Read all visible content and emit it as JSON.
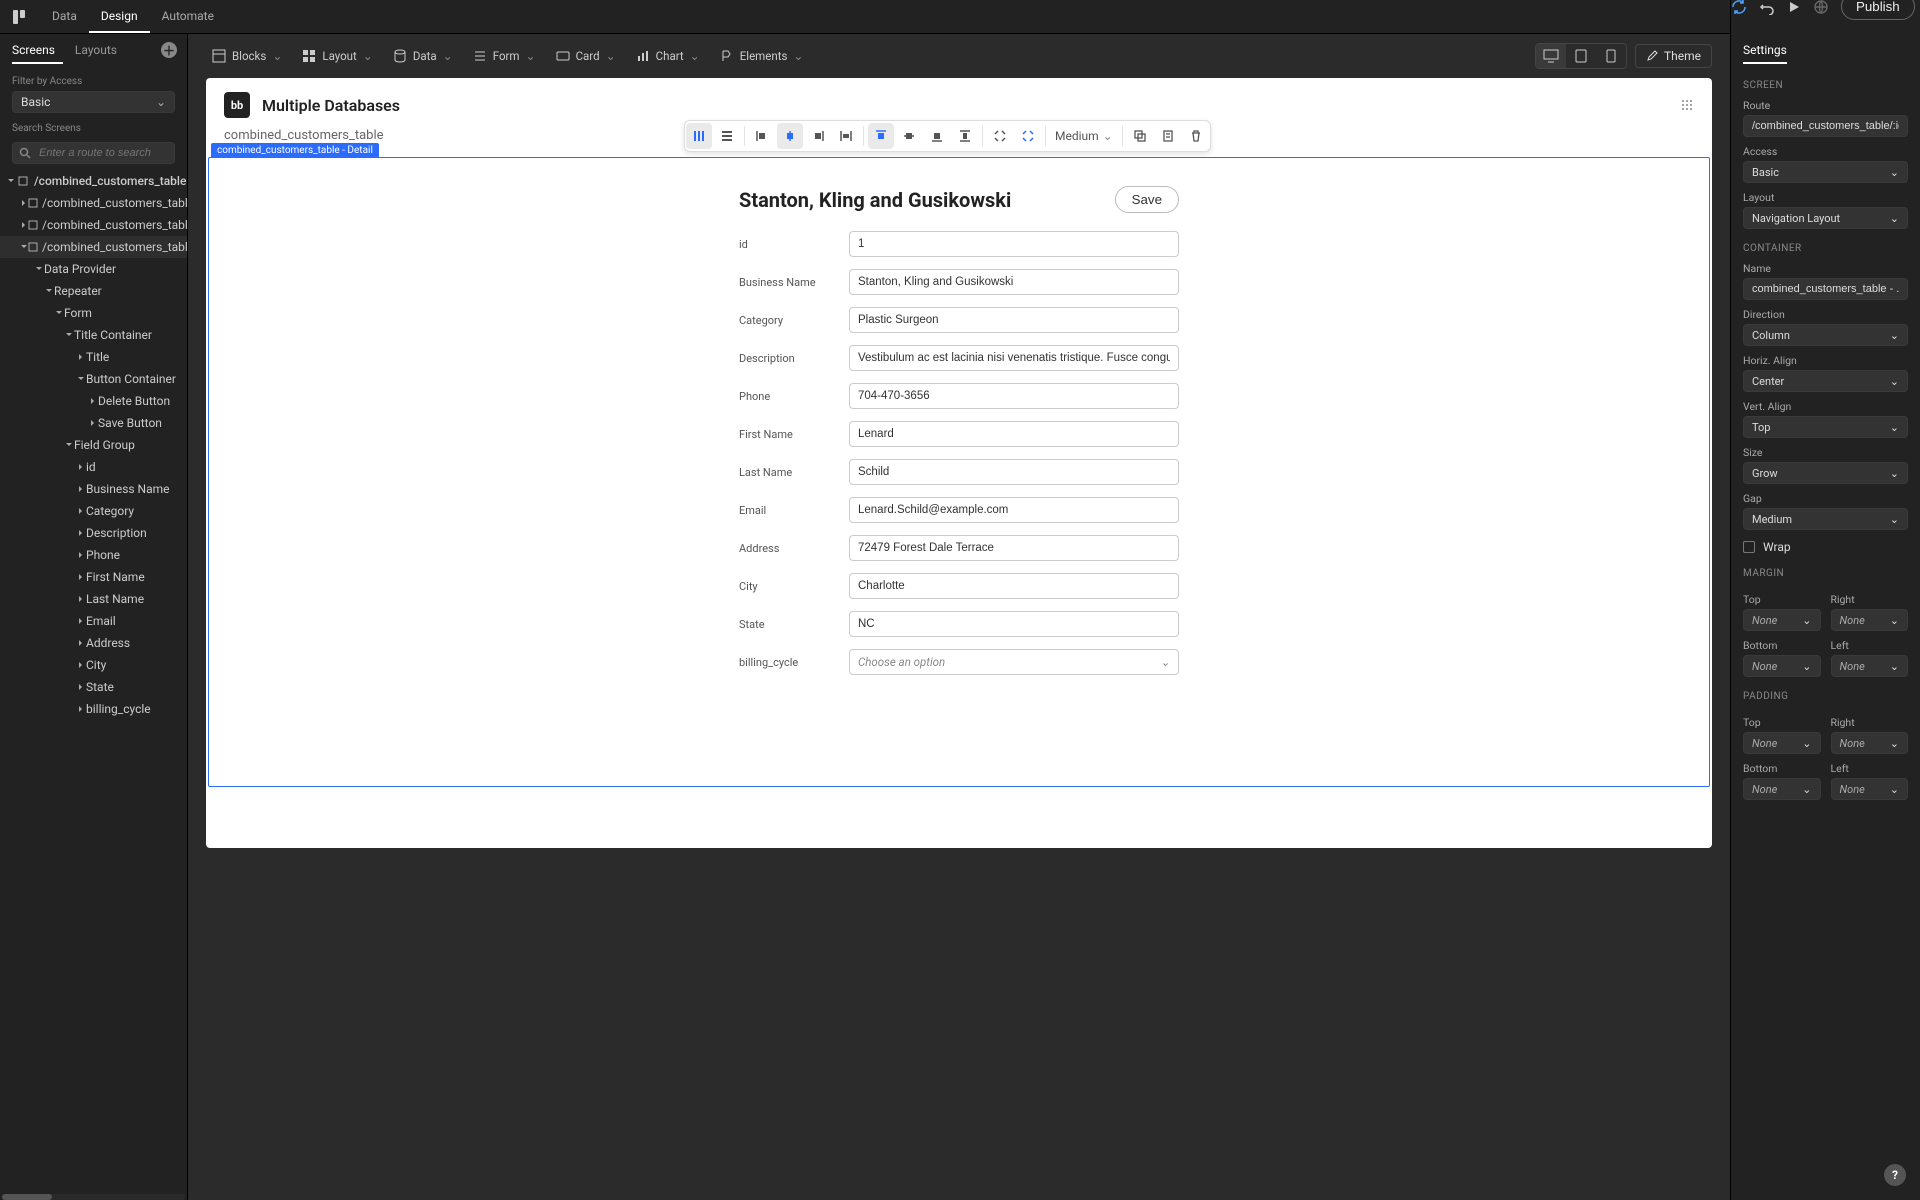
{
  "top": {
    "tabs": [
      "Data",
      "Design",
      "Automate"
    ],
    "active": 1,
    "publish": "Publish"
  },
  "left": {
    "tabs": [
      "Screens",
      "Layouts"
    ],
    "filterLabel": "Filter by Access",
    "filterValue": "Basic",
    "searchLabel": "Search Screens",
    "searchPlaceholder": "Enter a route to search",
    "tree": {
      "root": "/combined_customers_table",
      "children": [
        "/combined_customers_table",
        "/combined_customers_table...",
        "/combined_customers_table..."
      ],
      "provider": "Data Provider",
      "repeater": "Repeater",
      "form": "Form",
      "titleContainer": "Title Container",
      "title": "Title",
      "buttonContainer": "Button Container",
      "deleteBtn": "Delete Button",
      "saveBtn": "Save Button",
      "fieldGroup": "Field Group",
      "fields": [
        "id",
        "Business Name",
        "Category",
        "Description",
        "Phone",
        "First Name",
        "Last Name",
        "Email",
        "Address",
        "City",
        "State",
        "billing_cycle"
      ]
    }
  },
  "toolbar": {
    "items": [
      "Blocks",
      "Layout",
      "Data",
      "Form",
      "Card",
      "Chart",
      "Elements"
    ],
    "theme": "Theme"
  },
  "canvas": {
    "appTitle": "Multiple Databases",
    "breadcrumb": "combined_customers_table",
    "selectionTag": "combined_customers_table - Detail",
    "detailTitle": "Stanton, Kling and Gusikowski",
    "save": "Save",
    "ctxSize": "Medium",
    "fields": {
      "id": {
        "label": "id",
        "value": "1"
      },
      "business": {
        "label": "Business Name",
        "value": "Stanton, Kling and Gusikowski"
      },
      "category": {
        "label": "Category",
        "value": "Plastic Surgeon"
      },
      "description": {
        "label": "Description",
        "value": "Vestibulum ac est lacinia nisi venenatis tristique. Fusce congue, diam id ornare i…"
      },
      "phone": {
        "label": "Phone",
        "value": "704-470-3656"
      },
      "firstName": {
        "label": "First Name",
        "value": "Lenard"
      },
      "lastName": {
        "label": "Last Name",
        "value": "Schild"
      },
      "email": {
        "label": "Email",
        "value": "Lenard.Schild@example.com"
      },
      "address": {
        "label": "Address",
        "value": "72479 Forest Dale Terrace"
      },
      "city": {
        "label": "City",
        "value": "Charlotte"
      },
      "state": {
        "label": "State",
        "value": "NC"
      },
      "billing": {
        "label": "billing_cycle",
        "placeholder": "Choose an option"
      }
    }
  },
  "right": {
    "tab": "Settings",
    "screen": {
      "heading": "SCREEN",
      "routeLabel": "Route",
      "route": "/combined_customers_table/:id",
      "accessLabel": "Access",
      "access": "Basic",
      "layoutLabel": "Layout",
      "layout": "Navigation Layout"
    },
    "container": {
      "heading": "CONTAINER",
      "nameLabel": "Name",
      "name": "combined_customers_table - ...",
      "directionLabel": "Direction",
      "direction": "Column",
      "halignLabel": "Horiz. Align",
      "halign": "Center",
      "valignLabel": "Vert. Align",
      "valign": "Top",
      "sizeLabel": "Size",
      "size": "Grow",
      "gapLabel": "Gap",
      "gap": "Medium",
      "wrapLabel": "Wrap"
    },
    "margin": {
      "heading": "MARGIN",
      "topLabel": "Top",
      "rightLabel": "Right",
      "bottomLabel": "Bottom",
      "leftLabel": "Left",
      "none": "None"
    },
    "padding": {
      "heading": "PADDING",
      "topLabel": "Top",
      "rightLabel": "Right",
      "bottomLabel": "Bottom",
      "leftLabel": "Left",
      "none": "None"
    }
  },
  "help": "?"
}
